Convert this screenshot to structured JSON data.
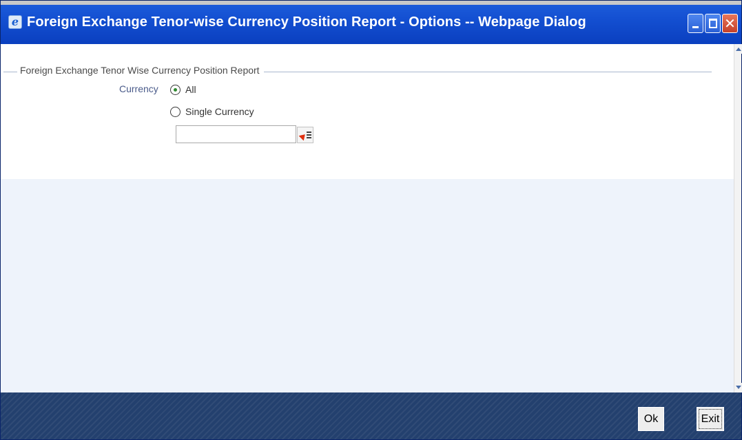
{
  "window": {
    "title": "Foreign Exchange Tenor-wise Currency Position Report - Options -- Webpage Dialog",
    "app_icon_glyph": "e"
  },
  "form": {
    "legend": "Foreign Exchange Tenor Wise Currency Position Report",
    "currency_label": "Currency",
    "option_all": "All",
    "option_single": "Single Currency",
    "selected_option": "All",
    "currency_value": ""
  },
  "footer": {
    "ok_label": "Ok",
    "exit_label": "Exit"
  },
  "colors": {
    "titlebar": "#1450d2",
    "footer": "#23406e",
    "content_bg": "#eef3fb"
  },
  "icons": [
    "app-icon",
    "minimize-icon",
    "maximize-icon",
    "close-icon",
    "list-of-values-icon",
    "scroll-up-icon",
    "scroll-down-icon"
  ]
}
